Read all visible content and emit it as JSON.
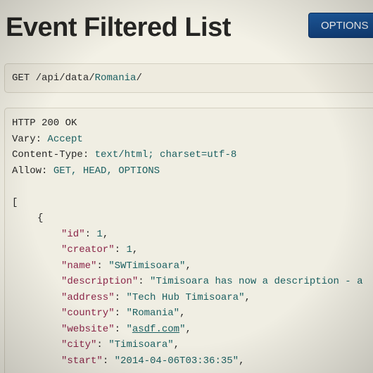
{
  "page": {
    "title": "Event Filtered List",
    "options_label": "OPTIONS"
  },
  "request": {
    "method": "GET",
    "path_prefix": "/api/data/",
    "path_segment": "Romania",
    "path_suffix": "/"
  },
  "response": {
    "status": "HTTP 200 OK",
    "headers": [
      {
        "name": "Vary:",
        "value": "Accept"
      },
      {
        "name": "Content-Type:",
        "value": "text/html; charset=utf-8"
      },
      {
        "name": "Allow:",
        "value": "GET, HEAD, OPTIONS"
      }
    ],
    "open_bracket": "[",
    "open_brace": "{",
    "fields": [
      {
        "key": "\"id\"",
        "sep": ": ",
        "value": "1",
        "end": ","
      },
      {
        "key": "\"creator\"",
        "sep": ": ",
        "value": "1",
        "end": ","
      },
      {
        "key": "\"name\"",
        "sep": ": ",
        "value": "\"SWTimisoara\"",
        "end": ","
      },
      {
        "key": "\"description\"",
        "sep": ": ",
        "value": "\"Timisoara has now a description - a",
        "end": ""
      },
      {
        "key": "\"address\"",
        "sep": ": ",
        "value": "\"Tech Hub Timisoara\"",
        "end": ","
      },
      {
        "key": "\"country\"",
        "sep": ": ",
        "value": "\"Romania\"",
        "end": ","
      },
      {
        "key": "\"website\"",
        "sep": ": ",
        "value_pre": "\"",
        "link": "asdf.com",
        "value_post": "\"",
        "end": ","
      },
      {
        "key": "\"city\"",
        "sep": ": ",
        "value": "\"Timisoara\"",
        "end": ","
      },
      {
        "key": "\"start\"",
        "sep": ": ",
        "value": "\"2014-04-06T03:36:35\"",
        "end": ","
      }
    ]
  }
}
